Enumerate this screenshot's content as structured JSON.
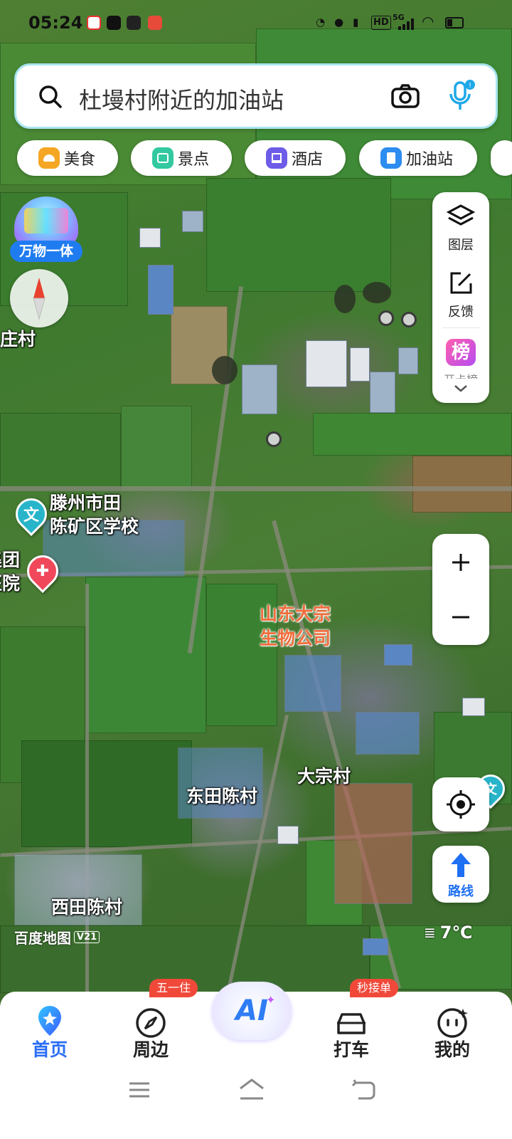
{
  "status_bar": {
    "time": "05:24",
    "network": "5G",
    "hd": "HD"
  },
  "search": {
    "text": "杜墁村附近的加油站",
    "left_icon": "search-icon",
    "camera_icon": "camera-icon",
    "voice_icon": "microphone-icon"
  },
  "categories": [
    {
      "label": "美食",
      "icon": "food-icon",
      "color": "#f5a623"
    },
    {
      "label": "景点",
      "icon": "scenic-icon",
      "color": "#33c9a0"
    },
    {
      "label": "酒店",
      "icon": "hotel-icon",
      "color": "#6c5ce7"
    },
    {
      "label": "加油站",
      "icon": "gas-station-icon",
      "color": "#2d8cf0"
    }
  ],
  "left_widgets": {
    "promo_label": "万物一体"
  },
  "right_panel": {
    "layers_label": "图层",
    "feedback_label": "反馈",
    "rank_badge": "榜",
    "rank_label_partial": "开卡榜"
  },
  "map_labels": {
    "cun_fragment": "庄村",
    "school_line1": "滕州市田",
    "school_line2": "陈矿区学校",
    "hospital_line1": "集团",
    "hospital_line2": "医院",
    "company_line1": "山东大宗",
    "company_line2": "生物公司",
    "dazong": "大宗村",
    "dongtianchen": "东田陈村",
    "xitianchen": "西田陈村",
    "watermark": "百度地图",
    "watermark_version": "V21",
    "weather": "7℃"
  },
  "route_button": {
    "label": "路线"
  },
  "bottom_nav": {
    "items": [
      {
        "label": "首页",
        "icon": "location-pin-icon",
        "active": true
      },
      {
        "label": "周边",
        "icon": "compass-icon",
        "badge": "五一住"
      },
      {
        "label": "AI",
        "icon": "ai-icon"
      },
      {
        "label": "打车",
        "icon": "car-icon",
        "badge": "秒接单"
      },
      {
        "label": "我的",
        "icon": "profile-face-icon"
      }
    ]
  },
  "colors": {
    "brand_blue": "#2a6df5",
    "badge_red": "#f0493a",
    "label_orange": "#f06d3d"
  }
}
